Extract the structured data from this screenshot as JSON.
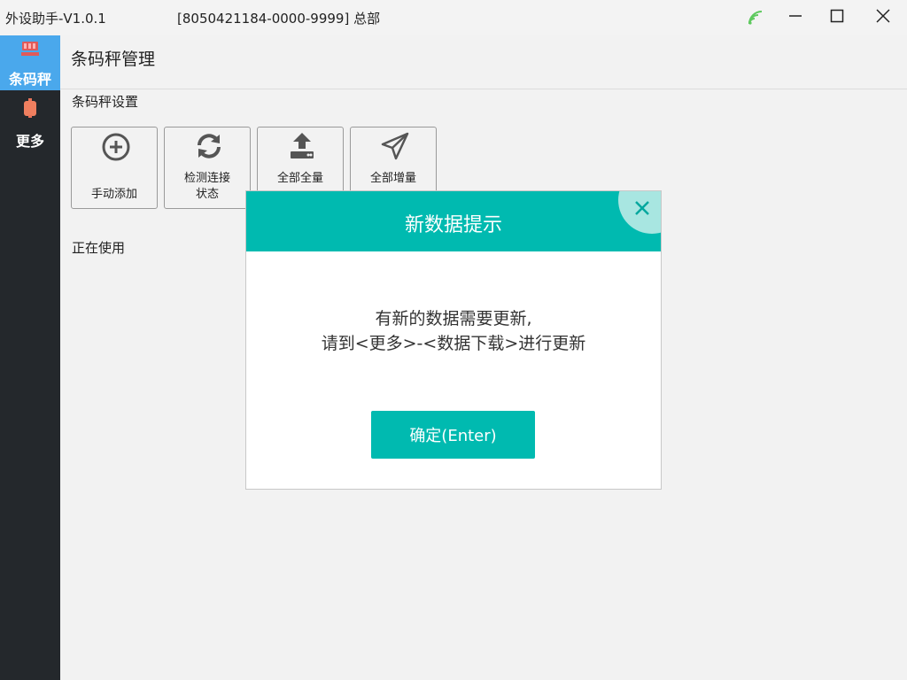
{
  "window": {
    "app_title": "外设助手-V1.0.1",
    "device_info": "[8050421184-0000-9999] 总部",
    "icons": [
      "wifi-icon",
      "minimize-icon",
      "maximize-icon",
      "close-icon"
    ]
  },
  "sidebar": {
    "items": [
      {
        "label": "条码秤",
        "icon": "scale-icon",
        "active": true
      },
      {
        "label": "更多",
        "icon": "more-icon",
        "active": false
      }
    ]
  },
  "main": {
    "page_title": "条码秤管理",
    "section_title": "条码秤设置",
    "toolbar": [
      {
        "label": "手动添加",
        "icon": "add-circle-icon"
      },
      {
        "label": "检测连接状态",
        "line1": "检测连接",
        "line2": "状态",
        "icon": "refresh-icon"
      },
      {
        "label": "全部全量",
        "icon": "upload-icon"
      },
      {
        "label": "全部增量",
        "icon": "send-icon"
      }
    ],
    "in_use_title": "正在使用"
  },
  "dialog": {
    "title": "新数据提示",
    "message_line1": "有新的数据需要更新,",
    "message_line2": "请到<更多>-<数据下载>进行更新",
    "confirm_label": "确定(Enter)"
  },
  "colors": {
    "accent": "#00bab0",
    "sidebar_bg": "#24282c",
    "sidebar_active": "#4aa8ec",
    "wifi": "#5ec95e"
  }
}
